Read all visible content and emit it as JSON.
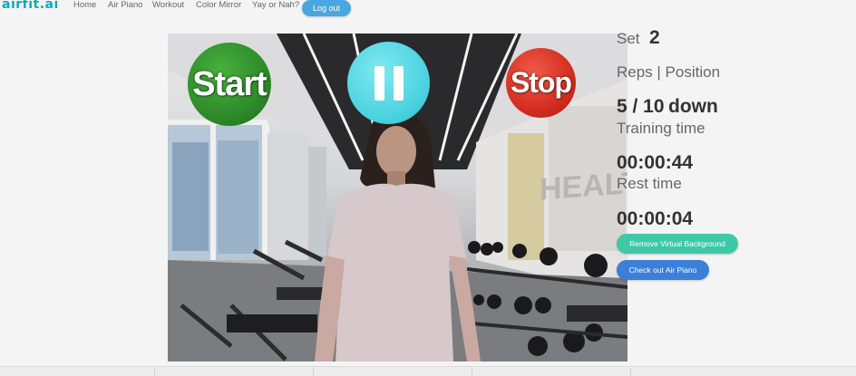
{
  "nav": {
    "logo": "airfit.ai",
    "links": [
      "Home",
      "Air Piano",
      "Workout",
      "Color Mirror",
      "Yay or Nah?"
    ],
    "logout_label": "Log out"
  },
  "video": {
    "start_label": "Start",
    "pause_icon": "pause-icon",
    "stop_label": "Stop",
    "wall_sign": "HEALTH",
    "colors": {
      "start": "#2e8b2a",
      "pause": "#4fd4e2",
      "stop": "#d42e20"
    }
  },
  "stats": {
    "set_label": "Set",
    "set_value": "2",
    "reps_label": "Reps | Position",
    "reps_value": "5 / 10",
    "position_value": "down",
    "training_label": "Training time",
    "training_value": "00:00:44",
    "rest_label": "Rest time",
    "rest_value": "00:00:04"
  },
  "buttons": {
    "remove_bg": "Remove Virtual Background",
    "air_piano": "Check out Air Piano",
    "colors": {
      "remove_bg": "#3ec8a8",
      "air_piano": "#3b7fd9"
    }
  }
}
